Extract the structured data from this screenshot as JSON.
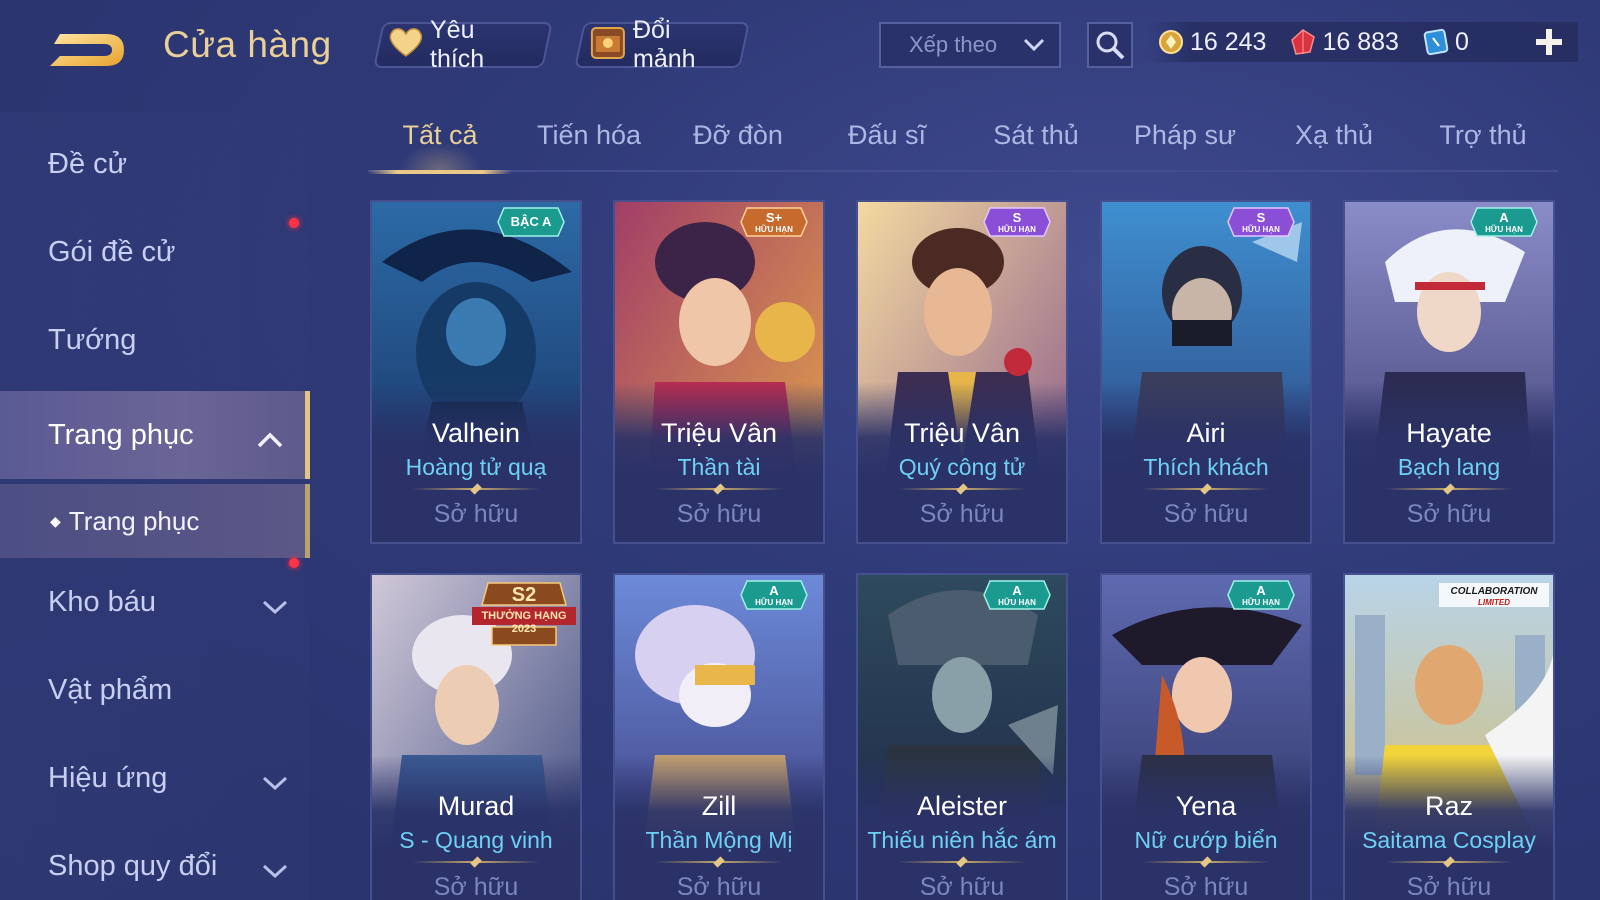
{
  "header": {
    "title": "Cửa hàng",
    "favorite_label": "Yêu thích",
    "exchange_label": "Đổi mảnh",
    "sort_placeholder": "Xếp theo"
  },
  "currency": {
    "gold": "16 243",
    "gems": "16 883",
    "tokens": "0"
  },
  "sidebar": {
    "items": [
      {
        "label": "Đề cử"
      },
      {
        "label": "Gói đề cử"
      },
      {
        "label": "Tướng"
      },
      {
        "label": "Trang phục"
      },
      {
        "label": "Trang phục"
      },
      {
        "label": "Kho báu"
      },
      {
        "label": "Vật phẩm"
      },
      {
        "label": "Hiệu ứng"
      },
      {
        "label": "Shop quy đổi"
      }
    ]
  },
  "tabs": [
    {
      "label": "Tất cả"
    },
    {
      "label": "Tiến hóa"
    },
    {
      "label": "Đỡ đòn"
    },
    {
      "label": "Đấu sĩ"
    },
    {
      "label": "Sát thủ"
    },
    {
      "label": "Pháp sư"
    },
    {
      "label": "Xạ thủ"
    },
    {
      "label": "Trợ thủ"
    }
  ],
  "cards": [
    {
      "hero": "Valhein",
      "skin": "Hoàng tử quạ",
      "status": "Sở hữu",
      "badge": "BẬC A",
      "badge_sub": ""
    },
    {
      "hero": "Triệu Vân",
      "skin": "Thần tài",
      "status": "Sở hữu",
      "badge": "S+",
      "badge_sub": "HỮU HẠN"
    },
    {
      "hero": "Triệu Vân",
      "skin": "Quý công tử",
      "status": "Sở hữu",
      "badge": "S",
      "badge_sub": "HỮU HẠN"
    },
    {
      "hero": "Airi",
      "skin": "Thích khách",
      "status": "Sở hữu",
      "badge": "S",
      "badge_sub": "HỮU HẠN"
    },
    {
      "hero": "Hayate",
      "skin": "Bạch lang",
      "status": "Sở hữu",
      "badge": "A",
      "badge_sub": "HỮU HẠN"
    },
    {
      "hero": "Murad",
      "skin": "S - Quang vinh",
      "status": "Sở hữu",
      "badge": "S2",
      "badge_sub": "THƯỞNG HẠNG 2023"
    },
    {
      "hero": "Zill",
      "skin": "Thần Mộng Mị",
      "status": "Sở hữu",
      "badge": "A",
      "badge_sub": "HỮU HẠN"
    },
    {
      "hero": "Aleister",
      "skin": "Thiếu niên hắc ám",
      "status": "Sở hữu",
      "badge": "A",
      "badge_sub": "HỮU HẠN"
    },
    {
      "hero": "Yena",
      "skin": "Nữ cướp biển",
      "status": "Sở hữu",
      "badge": "A",
      "badge_sub": "HỮU HẠN"
    },
    {
      "hero": "Raz",
      "skin": "Saitama Cosplay",
      "status": "Sở hữu",
      "badge": "COLLABORATION",
      "badge_sub": "LIMITED"
    }
  ],
  "colors": {
    "accent_gold": "#e9cf98",
    "skin_name": "#6fd0f5",
    "badge_a": "#1fa39a",
    "badge_s": "#8a4fd6",
    "badge_splus": "#c76a2e",
    "notification": "#ff3344"
  }
}
